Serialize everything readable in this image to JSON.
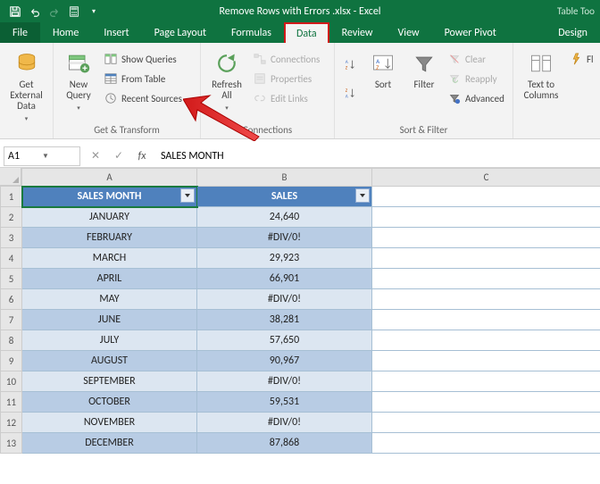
{
  "titlebar": {
    "title": "Remove Rows with Errors .xlsx - Excel",
    "context_tab": "Table Too"
  },
  "tabs": {
    "file": "File",
    "home": "Home",
    "insert": "Insert",
    "page_layout": "Page Layout",
    "formulas": "Formulas",
    "data": "Data",
    "review": "Review",
    "view": "View",
    "power_pivot": "Power Pivot",
    "design": "Design"
  },
  "ribbon": {
    "external": {
      "label": "Get External\nData"
    },
    "transform": {
      "new_query": "New\nQuery",
      "show_queries": "Show Queries",
      "from_table": "From Table",
      "recent_sources": "Recent Sources",
      "group": "Get & Transform"
    },
    "connections": {
      "refresh": "Refresh\nAll",
      "connections": "Connections",
      "properties": "Properties",
      "edit_links": "Edit Links",
      "group": "Connections"
    },
    "sort": {
      "sort": "Sort",
      "filter": "Filter",
      "clear": "Clear",
      "reapply": "Reapply",
      "advanced": "Advanced",
      "group": "Sort & Filter"
    },
    "datatools": {
      "ttc": "Text to\nColumns",
      "ff": "Fl"
    }
  },
  "formula_bar": {
    "name": "A1",
    "fx": "fx",
    "value": "SALES MONTH"
  },
  "columns": [
    "A",
    "B",
    "C"
  ],
  "table": {
    "headers": [
      "SALES MONTH",
      "SALES"
    ],
    "rows": [
      [
        "JANUARY",
        "24,640"
      ],
      [
        "FEBRUARY",
        "#DIV/0!"
      ],
      [
        "MARCH",
        "29,923"
      ],
      [
        "APRIL",
        "66,901"
      ],
      [
        "MAY",
        "#DIV/0!"
      ],
      [
        "JUNE",
        "38,281"
      ],
      [
        "JULY",
        "57,650"
      ],
      [
        "AUGUST",
        "90,967"
      ],
      [
        "SEPTEMBER",
        "#DIV/0!"
      ],
      [
        "OCTOBER",
        "59,531"
      ],
      [
        "NOVEMBER",
        "#DIV/0!"
      ],
      [
        "DECEMBER",
        "87,868"
      ]
    ]
  }
}
